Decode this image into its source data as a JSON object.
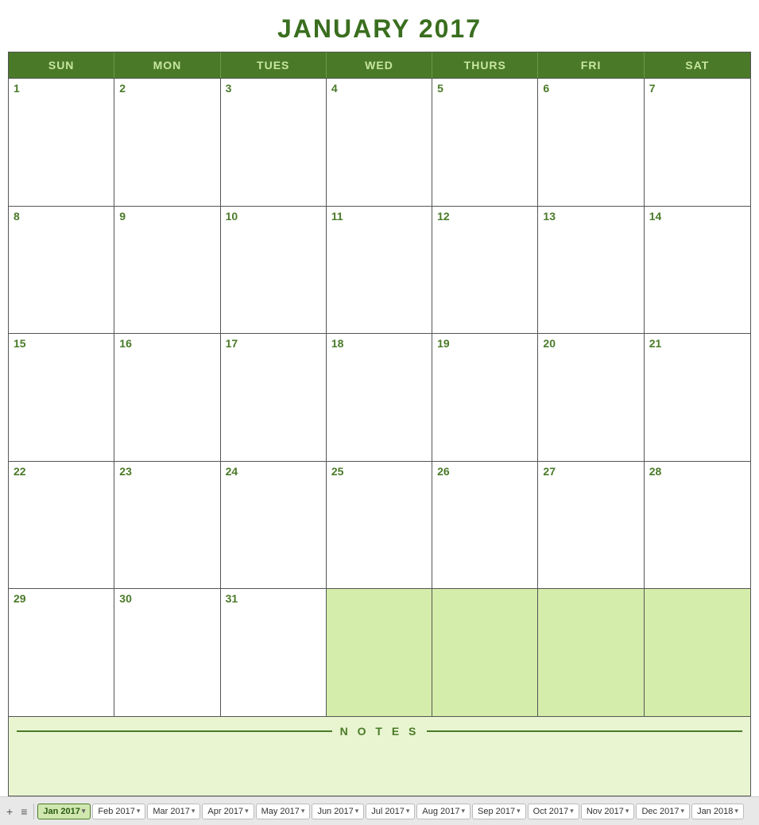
{
  "calendar": {
    "title": "JANUARY 2017",
    "days_of_week": [
      "SUN",
      "MON",
      "TUES",
      "WED",
      "THURS",
      "FRI",
      "SAT"
    ],
    "weeks": [
      [
        {
          "number": "1",
          "empty": false
        },
        {
          "number": "2",
          "empty": false
        },
        {
          "number": "3",
          "empty": false
        },
        {
          "number": "4",
          "empty": false
        },
        {
          "number": "5",
          "empty": false
        },
        {
          "number": "6",
          "empty": false
        },
        {
          "number": "7",
          "empty": false
        }
      ],
      [
        {
          "number": "8",
          "empty": false
        },
        {
          "number": "9",
          "empty": false
        },
        {
          "number": "10",
          "empty": false
        },
        {
          "number": "11",
          "empty": false
        },
        {
          "number": "12",
          "empty": false
        },
        {
          "number": "13",
          "empty": false
        },
        {
          "number": "14",
          "empty": false
        }
      ],
      [
        {
          "number": "15",
          "empty": false
        },
        {
          "number": "16",
          "empty": false
        },
        {
          "number": "17",
          "empty": false
        },
        {
          "number": "18",
          "empty": false
        },
        {
          "number": "19",
          "empty": false
        },
        {
          "number": "20",
          "empty": false
        },
        {
          "number": "21",
          "empty": false
        }
      ],
      [
        {
          "number": "22",
          "empty": false
        },
        {
          "number": "23",
          "empty": false
        },
        {
          "number": "24",
          "empty": false
        },
        {
          "number": "25",
          "empty": false
        },
        {
          "number": "26",
          "empty": false
        },
        {
          "number": "27",
          "empty": false
        },
        {
          "number": "28",
          "empty": false
        }
      ],
      [
        {
          "number": "29",
          "empty": false
        },
        {
          "number": "30",
          "empty": false
        },
        {
          "number": "31",
          "empty": false
        },
        {
          "number": "",
          "empty": true
        },
        {
          "number": "",
          "empty": true
        },
        {
          "number": "",
          "empty": true
        },
        {
          "number": "",
          "empty": true
        }
      ]
    ],
    "notes_label": "N O T E S"
  },
  "tabs": {
    "add_icon": "+",
    "menu_icon": "≡",
    "items": [
      {
        "label": "Jan 2017",
        "active": true
      },
      {
        "label": "Feb 2017",
        "active": false
      },
      {
        "label": "Mar 2017",
        "active": false
      },
      {
        "label": "Apr 2017",
        "active": false
      },
      {
        "label": "May 2017",
        "active": false
      },
      {
        "label": "Jun 2017",
        "active": false
      },
      {
        "label": "Jul 2017",
        "active": false
      },
      {
        "label": "Aug 2017",
        "active": false
      },
      {
        "label": "Sep 2017",
        "active": false
      },
      {
        "label": "Oct 2017",
        "active": false
      },
      {
        "label": "Nov 2017",
        "active": false
      },
      {
        "label": "Dec 2017",
        "active": false
      },
      {
        "label": "Jan 2018",
        "active": false
      }
    ]
  }
}
